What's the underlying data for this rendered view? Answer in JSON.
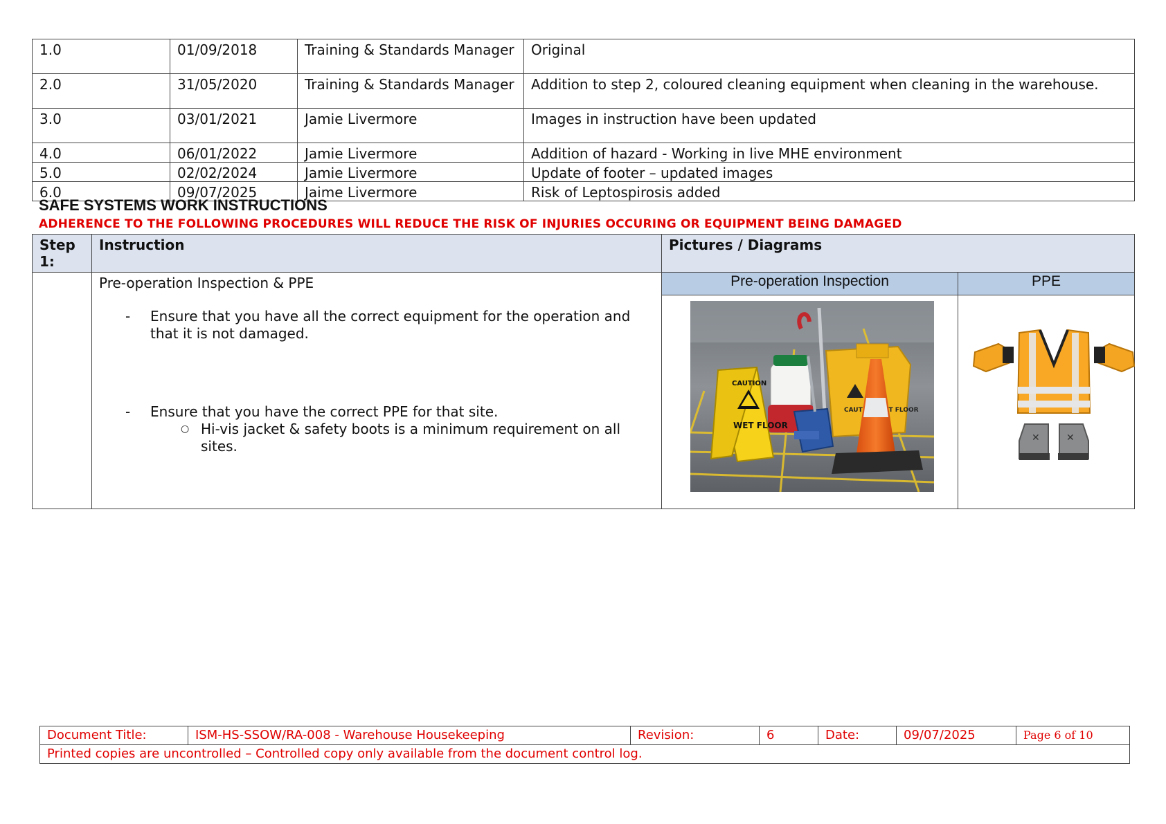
{
  "revision_history": [
    {
      "version": "1.0",
      "date": "01/09/2018",
      "author": "Training & Standards Manager",
      "change": "Original"
    },
    {
      "version": "2.0",
      "date": "31/05/2020",
      "author": "Training & Standards Manager",
      "change": "Addition to step 2, coloured cleaning equipment when cleaning in the warehouse."
    },
    {
      "version": "3.0",
      "date": "03/01/2021",
      "author": "Jamie Livermore",
      "change": "Images in instruction have been updated"
    },
    {
      "version": "4.0",
      "date": "06/01/2022",
      "author": "Jamie Livermore",
      "change": "Addition of hazard - Working in live MHE environment"
    },
    {
      "version": "5.0",
      "date": "02/02/2024",
      "author": "Jamie Livermore",
      "change": "Update of footer – updated images"
    },
    {
      "version": "6.0",
      "date": "09/07/2025",
      "author": "Jaime Livermore",
      "change": "Risk of Leptospirosis added"
    }
  ],
  "safe_systems": {
    "heading": "SAFE SYSTEMS WORK INSTRUCTIONS",
    "warning": "ADHERENCE TO THE FOLLOWING PROCEDURES WILL REDUCE THE RISK OF INJURIES OCCURING OR EQUIPMENT BEING DAMAGED"
  },
  "step_table": {
    "header_step": "Step 1:",
    "header_instruction": "Instruction",
    "header_pictures": "Pictures / Diagrams",
    "instruction_title": "Pre-operation Inspection & PPE",
    "bullet_1": "Ensure that you have all the correct equipment for the operation and that it is not damaged.",
    "bullet_2": "Ensure that you have the correct PPE for that site.",
    "sub_bullet_1": "Hi-vis jacket & safety boots is a minimum requirement on all sites.",
    "picture_header_left": "Pre-operation Inspection",
    "picture_header_right": "PPE",
    "caution_sign_text": "CAUTION",
    "wet_floor_text": "WET FLOOR",
    "bucket_caution_text": "CAUTION WET FLOOR"
  },
  "footer": {
    "doc_title_label": "Document Title:",
    "doc_title_value": "ISM-HS-SSOW/RA-008 - Warehouse Housekeeping",
    "revision_label": "Revision:",
    "revision_value": "6",
    "date_label": "Date:",
    "date_value": "09/07/2025",
    "page": "Page 6 of 10",
    "printed_note": "Printed copies are uncontrolled – Controlled copy only available from the document control log."
  },
  "colors": {
    "warning_red": "#e00000",
    "header_fill": "#dce3ef",
    "subheader_fill": "#b8cce4"
  }
}
